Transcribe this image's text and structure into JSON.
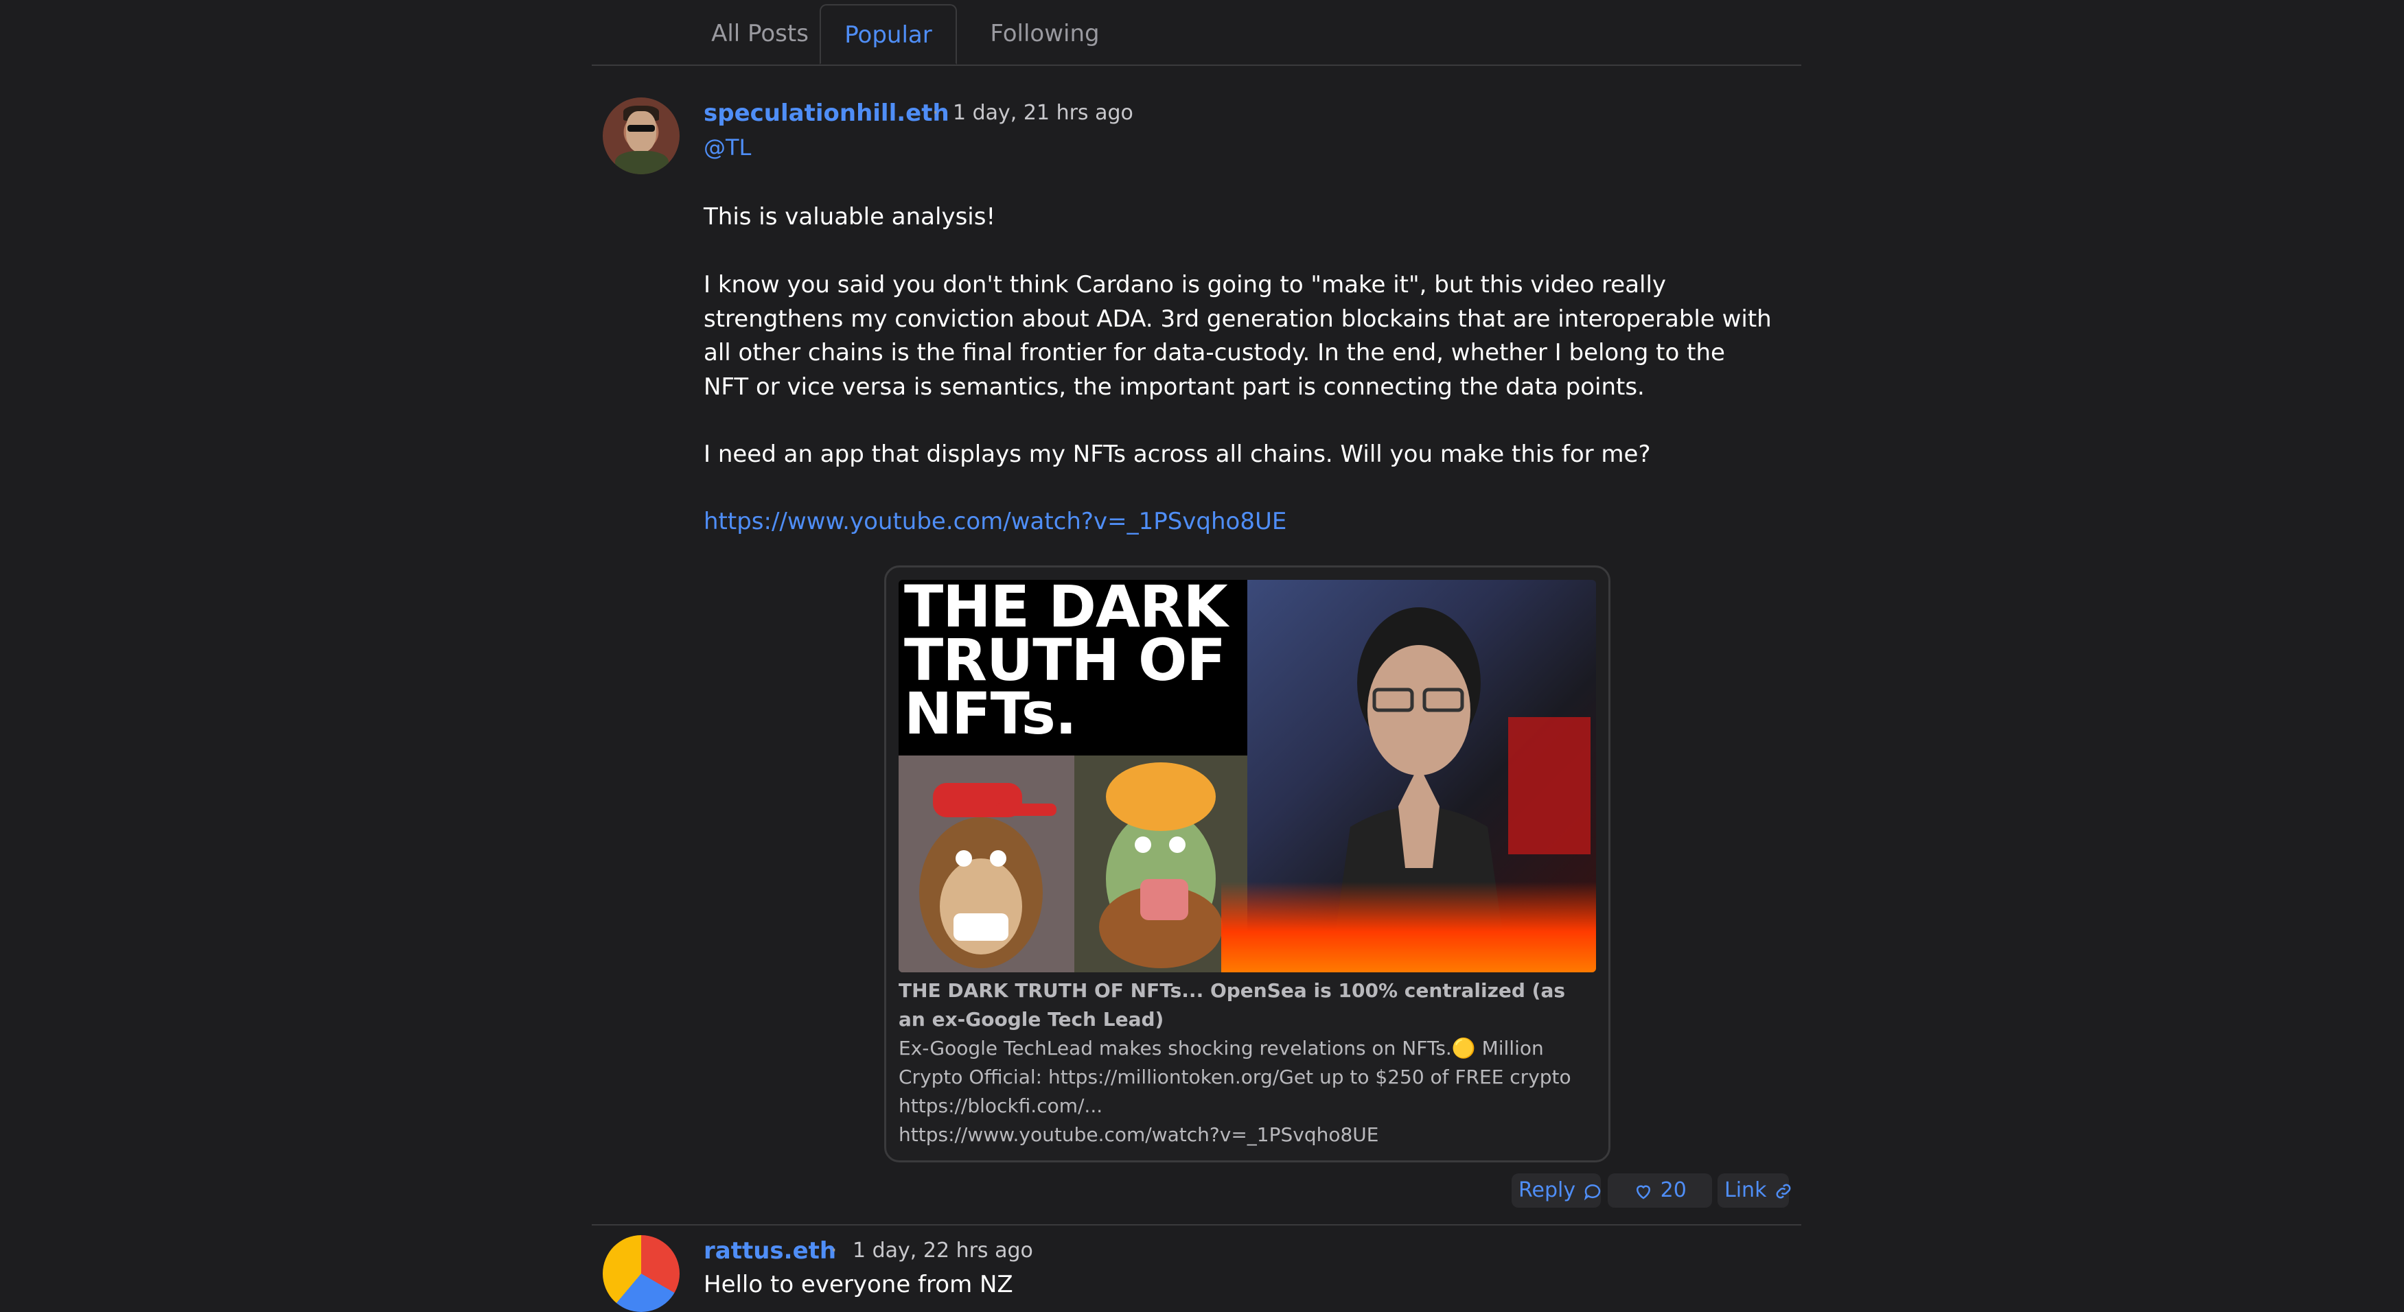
{
  "tabs": [
    {
      "label": "All Posts",
      "active": false
    },
    {
      "label": "Popular",
      "active": true
    },
    {
      "label": "Following",
      "active": false
    }
  ],
  "post1": {
    "username": "speculationhill.eth",
    "separator": "·",
    "timestamp": "1 day, 21 hrs ago",
    "mention": "@TL",
    "paragraphs": [
      "This is valuable analysis!",
      "I know you said you don't think Cardano is going to \"make it\", but this video really strengthens my conviction about ADA. 3rd generation blockains that are interoperable with all other chains is the final frontier for data-custody. In the end, whether I belong to the NFT or vice versa is semantics, the important part is connecting the data points.",
      "I need an app that displays my NFTs across all chains. Will you make this for me?"
    ],
    "link": "https://www.youtube.com/watch?v=_1PSvqho8UE",
    "embed": {
      "thumbnail_text": "THE DARK TRUTH OF NFTs.",
      "title": "THE DARK TRUTH OF NFTs... OpenSea is 100% centralized (as an ex-Google Tech Lead)",
      "description": "Ex-Google TechLead makes shocking revelations on NFTs.🟡 Million Crypto Official: https://milliontoken.org/Get up to $250 of FREE crypto https://blockfi.com/...",
      "url": "https://www.youtube.com/watch?v=_1PSvqho8UE"
    },
    "actions": {
      "reply": "Reply",
      "likes": "20",
      "link": "Link"
    }
  },
  "post2": {
    "username": "rattus.eth",
    "separator": "·",
    "timestamp": "1 day, 22 hrs ago",
    "text": "Hello to everyone from NZ"
  },
  "colors": {
    "background": "#1d1d1f",
    "accent": "#4f8ef7",
    "border": "#3a3a3c"
  }
}
